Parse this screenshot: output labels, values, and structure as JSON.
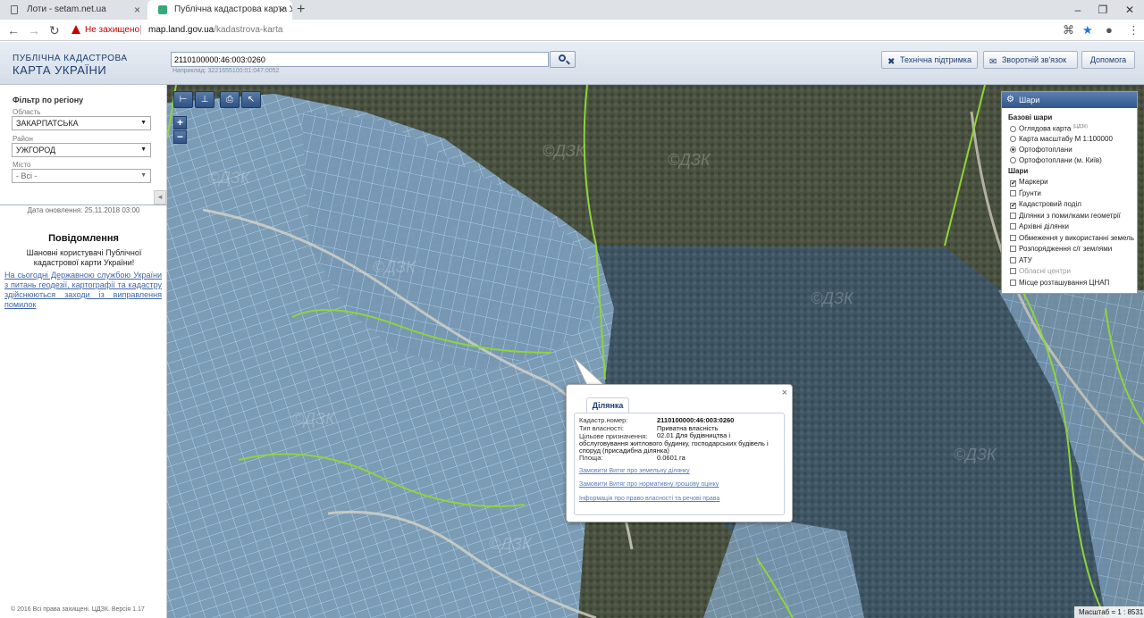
{
  "browser": {
    "tabs": [
      {
        "title": "Лоти - setam.net.ua"
      },
      {
        "title": "Публічна кадастрова карта Укр"
      }
    ],
    "not_secure": "Не захищено",
    "url_host": "map.land.gov.ua",
    "url_path": "/kadastrova-karta"
  },
  "header": {
    "logo_line1": "ПУБЛІЧНА КАДАСТРОВА",
    "logo_line2": "КАРТА УКРАЇНИ",
    "search_value": "2110100000:46:003:0260",
    "search_example": "Наприклад: 3221655100:01:047:0052",
    "buttons": {
      "support": "Технічна підтримка",
      "feedback": "Зворотній зв'язок",
      "help": "Допомога"
    }
  },
  "sidebar": {
    "filter_title": "Фільтр по регіону",
    "oblast_label": "Область",
    "oblast_value": "ЗАКАРПАТСЬКА",
    "rayon_label": "Район",
    "rayon_value": "УЖГОРОД",
    "misto_label": "Місто",
    "misto_value": "- Всі -",
    "update_date": "Дата оновлення: 25.11.2018 03:00",
    "message_title": "Повідомлення",
    "message_body": "Шановні користувачі Публічної кадастрової карти України!",
    "message_link": "На сьогодні Державною службою України з питань геодезії, картографії та кадастру здійснюються заходи із виправлення помилок",
    "footer": "© 2016 Всі права захищені. ЦДЗК. Версія 1.17"
  },
  "layers": {
    "title": "Шари",
    "base_title": "Базові шари",
    "base": [
      {
        "label": "Оглядова карта",
        "sup": "(ЦДЗК)",
        "checked": false
      },
      {
        "label": "Карта масштабу М 1:100000",
        "checked": false
      },
      {
        "label": "Ортофотоплани",
        "checked": true
      },
      {
        "label": "Ортофотоплани (м. Київ)",
        "checked": false
      }
    ],
    "overlay_title": "Шари",
    "overlays": [
      {
        "label": "Маркери",
        "checked": true,
        "dim": false
      },
      {
        "label": "Ґрунти",
        "checked": false,
        "dim": false
      },
      {
        "label": "Кадастровий поділ",
        "checked": true,
        "dim": false
      },
      {
        "label": "Ділянки з помилками геометрії",
        "checked": false,
        "dim": false
      },
      {
        "label": "Архівні ділянки",
        "checked": false,
        "dim": false
      },
      {
        "label": "Обмеження у використанні земель",
        "checked": false,
        "dim": false
      },
      {
        "label": "Розпорядження с/г землями",
        "checked": false,
        "dim": false
      },
      {
        "label": "АТУ",
        "checked": false,
        "dim": false
      },
      {
        "label": "Обласні центри",
        "checked": false,
        "dim": true
      },
      {
        "label": "Місце розташування ЦНАП",
        "checked": false,
        "dim": false
      }
    ]
  },
  "popup": {
    "tab": "Ділянка",
    "rows": [
      {
        "label": "Кадастр.номер:",
        "value": "2110100000:46:003:0260"
      },
      {
        "label": "Тип власності:",
        "value": "Приватна власність"
      },
      {
        "label": "Цільове призначення:",
        "value": "02.01 Для будівництва і обслуговування житлового будинку, господарських будівель і споруд (присадибна ділянка)"
      },
      {
        "label": "Площа:",
        "value": "0.0601 га"
      }
    ],
    "links": [
      "Замовити Витяг про земельну ділянку",
      "Замовити Витяг про нормативну грошову оцінку",
      "Інформація про право власності та речові права"
    ]
  },
  "map": {
    "watermark": "©ДЗК",
    "scale": "Масштаб = 1 : 8531"
  }
}
